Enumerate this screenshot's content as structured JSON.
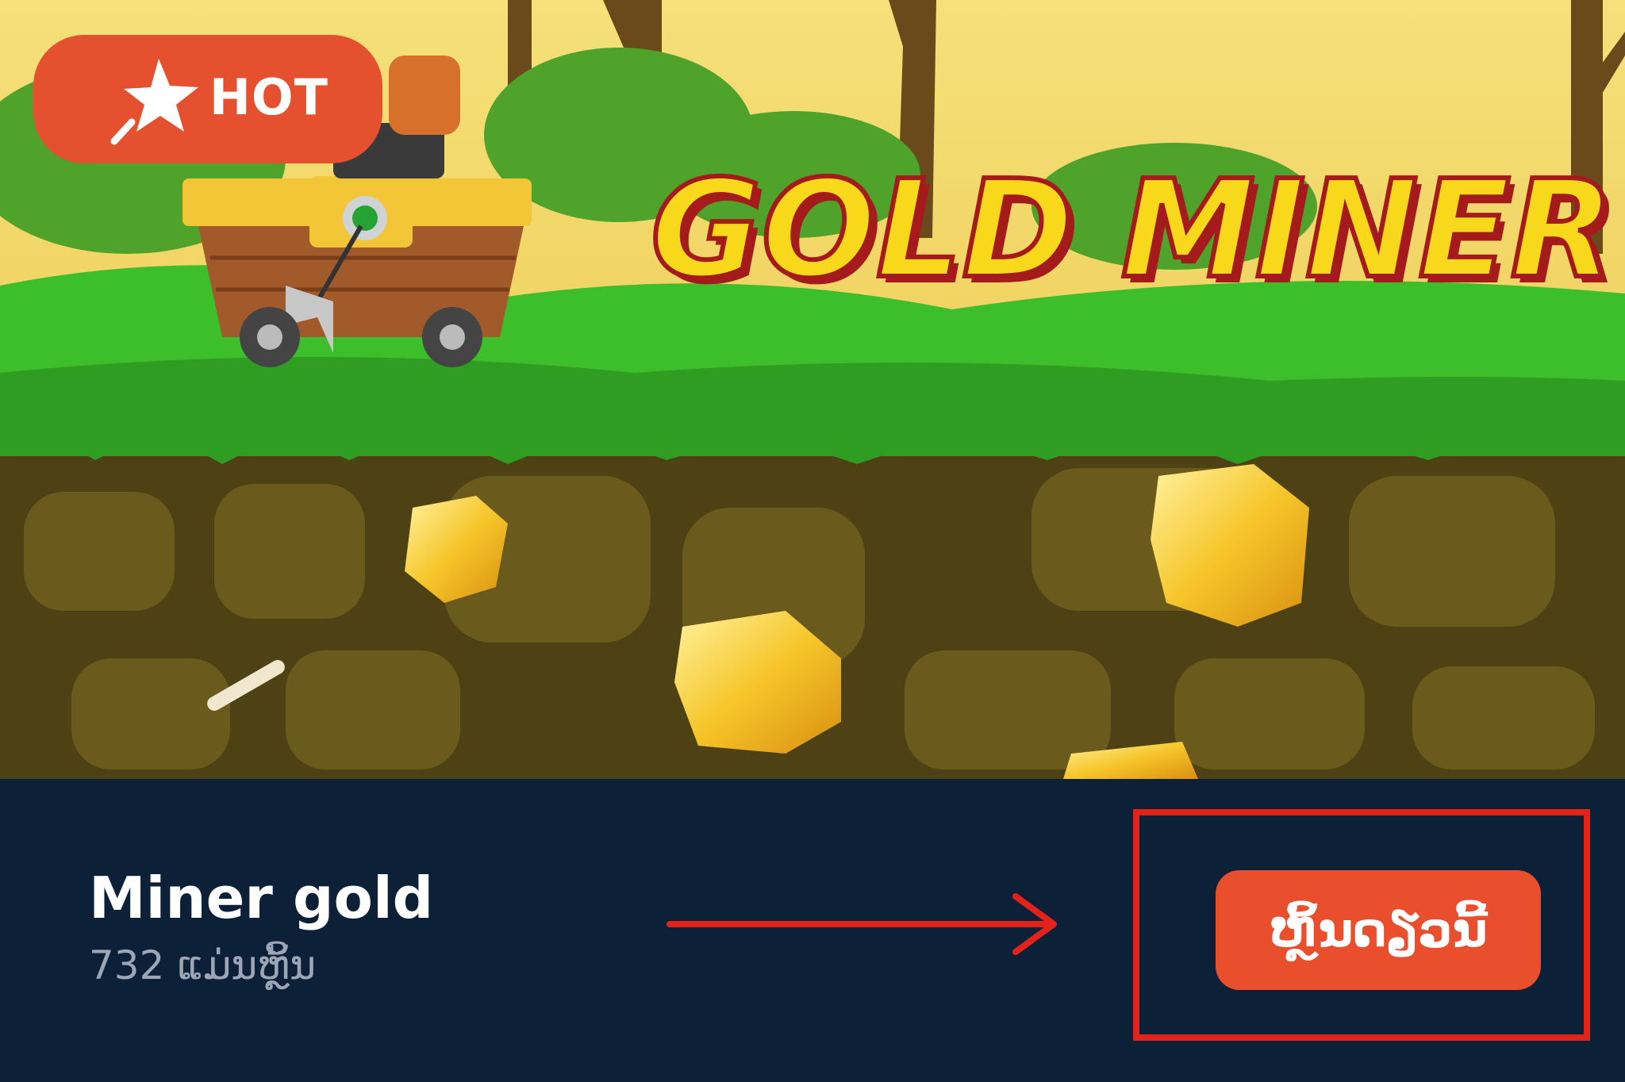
{
  "banner": {
    "logo_text": "GOLD MINER",
    "badge_label": "HOT",
    "colors": {
      "sky": "#f2d86a",
      "grass": "#3cbf2a",
      "dirt": "#4e4214",
      "gold": "#f3c12a",
      "badge": "#e5502f"
    }
  },
  "game": {
    "title": "Miner gold",
    "players": "732 ແມ່ນຫຼິ້ນ"
  },
  "play_button": {
    "label": "ຫຼິ້ນດຽວນີ້",
    "color": "#ea4f2d"
  },
  "icons": [
    "star-icon",
    "arrow-right-icon"
  ]
}
